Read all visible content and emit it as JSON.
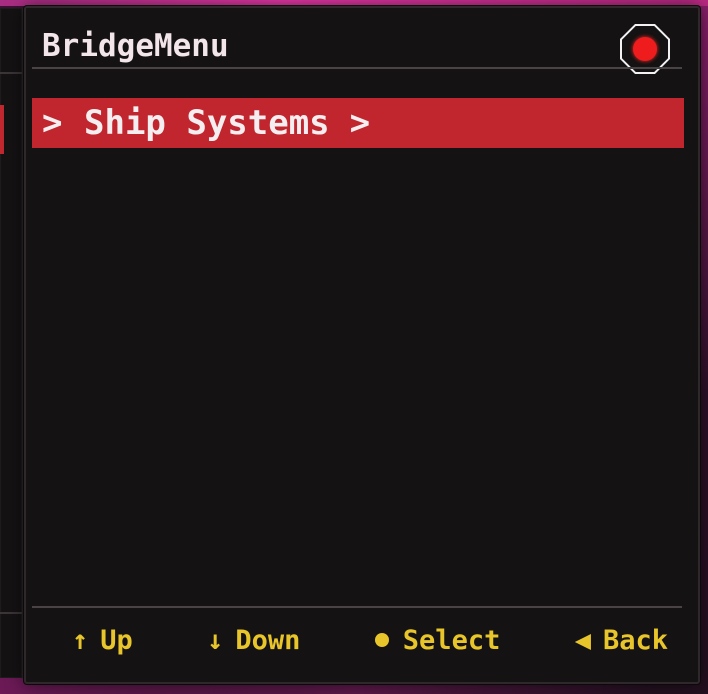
{
  "window": {
    "title": "BridgeMenu"
  },
  "status_indicator": {
    "icon": "record-dot-icon",
    "color": "#ee1c1c"
  },
  "menu": {
    "items": [
      {
        "prefix": ">",
        "label": "Ship Systems",
        "suffix": ">",
        "selected": true
      }
    ]
  },
  "footer": {
    "hints": [
      {
        "icon": "up-arrow-icon",
        "glyph": "↑",
        "label": "Up"
      },
      {
        "icon": "down-arrow-icon",
        "glyph": "↓",
        "label": "Down"
      },
      {
        "icon": "dot-icon",
        "glyph": "●",
        "label": "Select"
      },
      {
        "icon": "left-triangle-icon",
        "glyph": "◀",
        "label": "Back"
      }
    ]
  },
  "colors": {
    "highlight": "#c1262f",
    "hint_text": "#e8c52a",
    "title_text": "#f2e6ea"
  }
}
